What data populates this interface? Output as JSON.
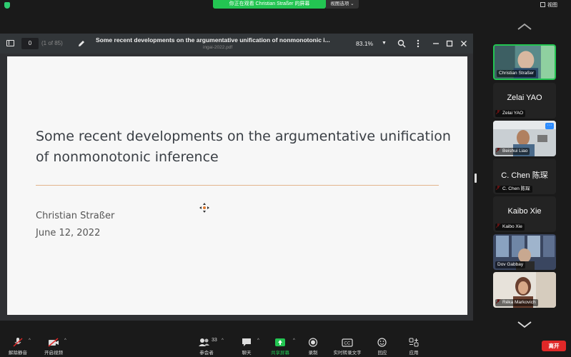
{
  "topbar": {
    "share_banner": "你正在观看 Christian Straßer 的屏幕",
    "view_options": "视图选项 ⌄",
    "view_label": "视图"
  },
  "pdf": {
    "page_input": "0",
    "page_count": "(1 of 85)",
    "title": "Some recent developments on the argumentative unification of nonmonotonic i...",
    "filename": "ingai-2022.pdf",
    "zoom": "83.1%"
  },
  "slide": {
    "title_line1": "Some recent developments on the argumentative unification",
    "title_line2": "of nonmonotonic inference",
    "author": "Christian Straßer",
    "date": "June 12, 2022",
    "rule_color": "#e2b48c"
  },
  "gallery": {
    "tiles": [
      {
        "name": "Christian Straßer",
        "big": "",
        "muted": false,
        "video": true
      },
      {
        "name": "Zelai YAO",
        "big": "Zelai YAO",
        "muted": true,
        "video": false
      },
      {
        "name": "Beishui Liao",
        "big": "",
        "muted": true,
        "video": true
      },
      {
        "name": "C. Chen 陈琛",
        "big": "C. Chen 陈琛",
        "muted": true,
        "video": false
      },
      {
        "name": "Kaibo Xie",
        "big": "Kaibo Xie",
        "muted": true,
        "video": false
      },
      {
        "name": "Dov Gabbay",
        "big": "",
        "muted": false,
        "video": true
      },
      {
        "name": "Réka Markovich",
        "big": "",
        "muted": true,
        "video": true
      }
    ]
  },
  "bottombar": {
    "unmute": "解除静音",
    "start_video": "开启视频",
    "participants": "参会者",
    "participant_count": "33",
    "chat": "聊天",
    "share_screen": "共享屏幕",
    "record": "录制",
    "live_transcript": "实时转录文字",
    "reactions": "回应",
    "apps": "应用",
    "leave": "离开",
    "accent": "#23c552",
    "leave_color": "#e02828"
  }
}
